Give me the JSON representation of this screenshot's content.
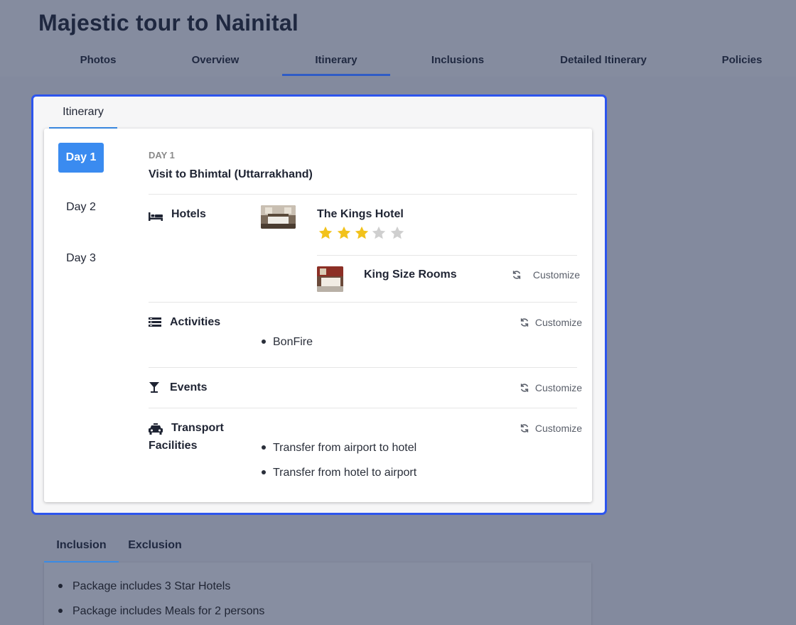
{
  "page": {
    "title": "Majestic tour to Nainital"
  },
  "nav": {
    "items": [
      {
        "label": "Photos"
      },
      {
        "label": "Overview"
      },
      {
        "label": "Itinerary"
      },
      {
        "label": "Inclusions"
      },
      {
        "label": "Detailed Itinerary"
      },
      {
        "label": "Policies"
      }
    ],
    "active": "Itinerary"
  },
  "modal": {
    "tab_label": "Itinerary",
    "days": [
      {
        "label": "Day 1"
      },
      {
        "label": "Day 2"
      },
      {
        "label": "Day 3"
      }
    ],
    "active_day": "Day 1",
    "day": {
      "label": "DAY 1",
      "title": "Visit to Bhimtal (Uttarrakhand)",
      "hotels": {
        "label": "Hotels",
        "name": "The Kings Hotel",
        "rating": 3,
        "max_rating": 5,
        "room": "King Size Rooms",
        "customize": "Customize"
      },
      "activities": {
        "label": "Activities",
        "items": [
          "BonFire"
        ],
        "customize": "Customize"
      },
      "events": {
        "label": "Events",
        "customize": "Customize"
      },
      "transport": {
        "label_line1": "Transport",
        "label_line2": "Facilities",
        "items": [
          "Transfer from airport to hotel",
          "Transfer from hotel to airport"
        ],
        "customize": "Customize"
      }
    }
  },
  "inclusion": {
    "tabs": [
      {
        "label": "Inclusion"
      },
      {
        "label": "Exclusion"
      }
    ],
    "active": "Inclusion",
    "items": [
      "Package includes 3 Star Hotels",
      "Package includes Meals for 2 persons"
    ]
  },
  "colors": {
    "accent": "#3a8bf0",
    "modal_border": "#2d55ee",
    "star_filled": "#f2c21b",
    "star_empty": "#cfcfcf"
  }
}
